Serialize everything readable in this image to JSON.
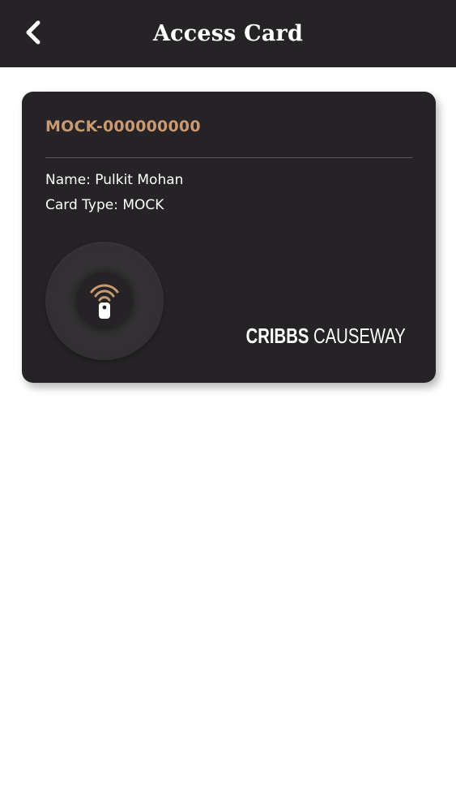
{
  "header": {
    "title": "Access Card",
    "back_icon": "chevron-left-icon"
  },
  "card": {
    "number": "MOCK-000000000",
    "name_line": "Name: Pulkit Mohan",
    "type_line": "Card Type: MOCK",
    "tap_icon": "nfc-tap-icon",
    "brand": {
      "strong": "CRIBBS",
      "light": "CAUSEWAY"
    }
  },
  "colors": {
    "header_bg": "#252325",
    "card_bg": "#252325",
    "accent": "#c99a72",
    "text": "#ffffff"
  }
}
